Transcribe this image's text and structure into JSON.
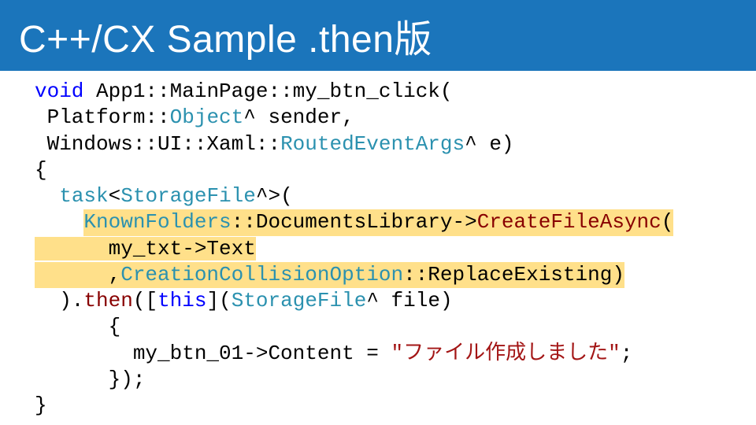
{
  "title": "C++/CX Sample .then版",
  "code": {
    "l1_a": "void",
    "l1_b": " App1::MainPage::my_btn_click(",
    "l2_a": " Platform::",
    "l2_b": "Object",
    "l2_c": "^ sender,",
    "l3_a": " Windows::UI::Xaml::",
    "l3_b": "RoutedEventArgs",
    "l3_c": "^ e)",
    "l4": "{",
    "l5_a": "  ",
    "l5_b": "task",
    "l5_c": "<",
    "l5_d": "StorageFile",
    "l5_e": "^>(",
    "l6_a": "    ",
    "l6_b": "KnownFolders",
    "l6_c": "::DocumentsLibrary->",
    "l6_d": "CreateFileAsync",
    "l6_e": "(",
    "l7_a": "      my_txt->Text",
    "l8_a": "      ,",
    "l8_b": "CreationCollisionOption",
    "l8_c": "::ReplaceExisting)",
    "l9_a": "  ).",
    "l9_b": "then",
    "l9_c": "([",
    "l9_d": "this",
    "l9_e": "](",
    "l9_f": "StorageFile",
    "l9_g": "^ file)",
    "l10": "      {",
    "l11_a": "        my_btn_01->Content = ",
    "l11_b": "\"ファイル作成しました\"",
    "l11_c": ";",
    "l12": "      });",
    "l13": "}"
  }
}
